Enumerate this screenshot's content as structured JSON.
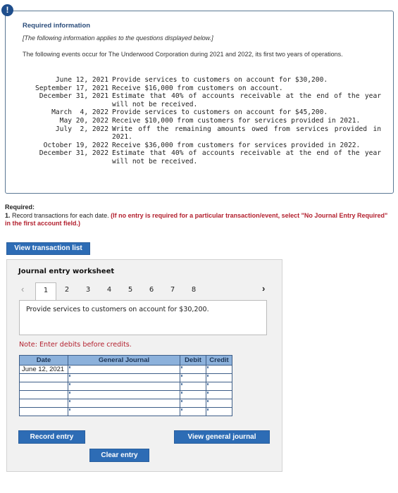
{
  "info": {
    "alert_icon": "exclamation-circle-icon",
    "title": "Required information",
    "subtitle": "[The following information applies to the questions displayed below.]",
    "intro": "The following events occur for The Underwood Corporation during 2021 and 2022, its first two years of operations.",
    "events": [
      {
        "date": "    June 12, 2021",
        "desc": "Provide services to customers on account for $30,200."
      },
      {
        "date": "September 17, 2021",
        "desc": "Receive $16,000 from customers on account."
      },
      {
        "date": " December 31, 2021",
        "desc": "Estimate that 40% of accounts receivable at the end of the year will not be received."
      },
      {
        "date": "   March  4, 2022",
        "desc": "Provide services to customers on account for $45,200."
      },
      {
        "date": "     May 20, 2022",
        "desc": "Receive $10,000 from customers for services provided in 2021."
      },
      {
        "date": "    July  2, 2022",
        "desc": "Write off the remaining amounts owed from services provided in 2021."
      },
      {
        "date": "  October 19, 2022",
        "desc": "Receive $36,000 from customers for services provided in 2022."
      },
      {
        "date": " December 31, 2022",
        "desc": "Estimate that 40% of accounts receivable at the end of the year will not be received."
      }
    ]
  },
  "required": {
    "heading": "Required:",
    "number": "1.",
    "text": " Record transactions for each date. ",
    "instruction": "(If no entry is required for a particular transaction/event, select \"No Journal Entry Required\" in the first account field.)"
  },
  "buttons": {
    "view_transaction_list": "View transaction list",
    "record_entry": "Record entry",
    "view_general_journal": "View general journal",
    "clear_entry": "Clear entry"
  },
  "worksheet": {
    "title": "Journal entry worksheet",
    "prev_icon": "chevron-left-icon",
    "next_icon": "chevron-right-icon",
    "tabs": [
      "1",
      "2",
      "3",
      "4",
      "5",
      "6",
      "7",
      "8"
    ],
    "active_tab": "1",
    "description": "Provide services to customers on account for $30,200.",
    "note": "Note: Enter debits before credits.",
    "columns": [
      "Date",
      "General Journal",
      "Debit",
      "Credit"
    ],
    "rows": [
      {
        "date": "June 12, 2021",
        "account": "",
        "debit": "",
        "credit": ""
      },
      {
        "date": "",
        "account": "",
        "debit": "",
        "credit": ""
      },
      {
        "date": "",
        "account": "",
        "debit": "",
        "credit": ""
      },
      {
        "date": "",
        "account": "",
        "debit": "",
        "credit": ""
      },
      {
        "date": "",
        "account": "",
        "debit": "",
        "credit": ""
      },
      {
        "date": "",
        "account": "",
        "debit": "",
        "credit": ""
      }
    ]
  },
  "colors": {
    "accent_blue": "#2d6cb5",
    "header_blue": "#8cb1db",
    "warning_red": "#b3212f",
    "title_navy": "#2a4c7a"
  }
}
